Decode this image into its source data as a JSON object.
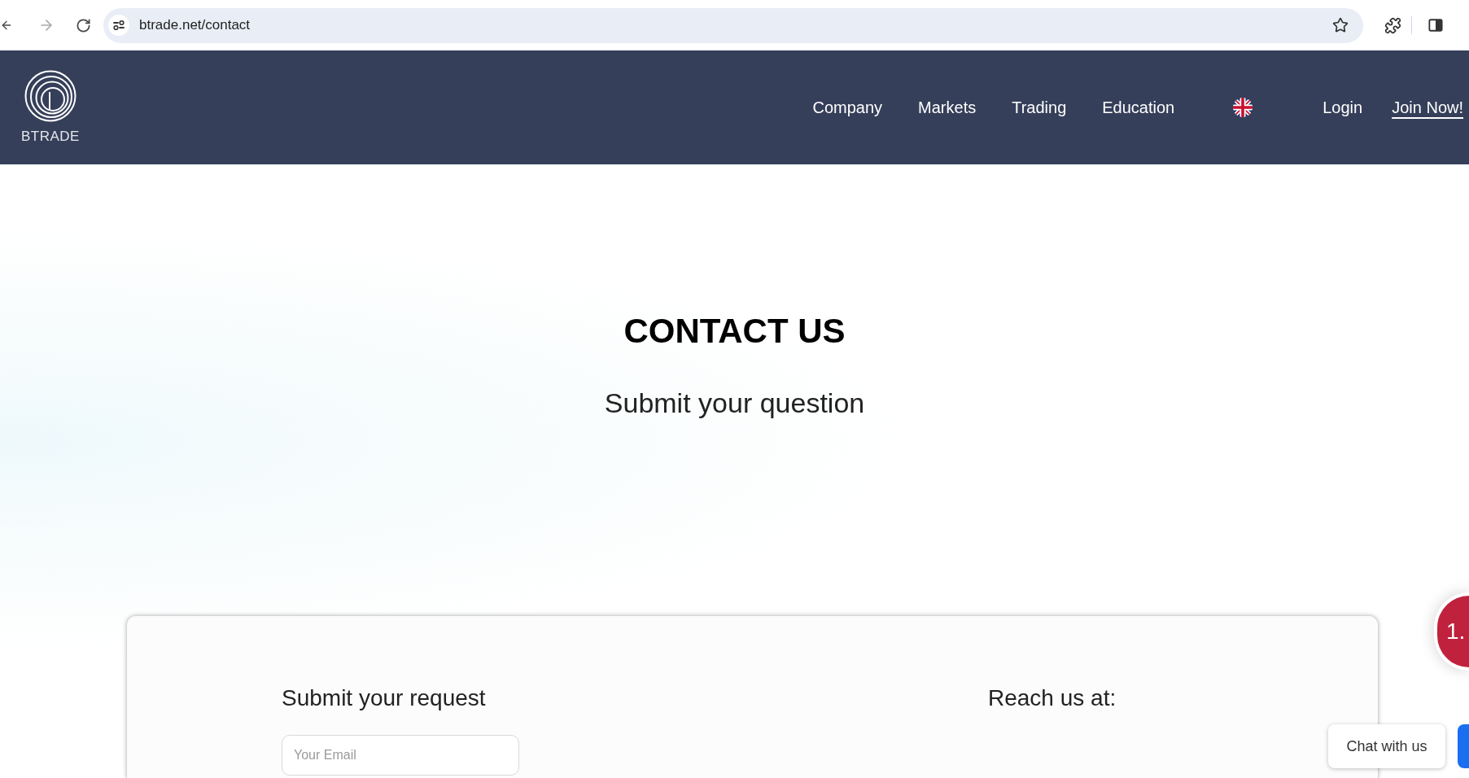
{
  "browser": {
    "url": "btrade.net/contact",
    "back_enabled": true,
    "forward_enabled": false
  },
  "header": {
    "logo_text": "BTRADE",
    "nav": [
      {
        "label": "Company"
      },
      {
        "label": "Markets"
      },
      {
        "label": "Trading"
      },
      {
        "label": "Education"
      }
    ],
    "login": "Login",
    "join": "Join Now!"
  },
  "hero": {
    "title": "CONTACT US",
    "subtitle": "Submit your question"
  },
  "card": {
    "form_title": "Submit your request",
    "email": {
      "placeholder": "Your Email"
    },
    "reach_title": "Reach us at:"
  },
  "widgets": {
    "notification_badge": "1.",
    "chat_prompt": "Chat with us"
  }
}
